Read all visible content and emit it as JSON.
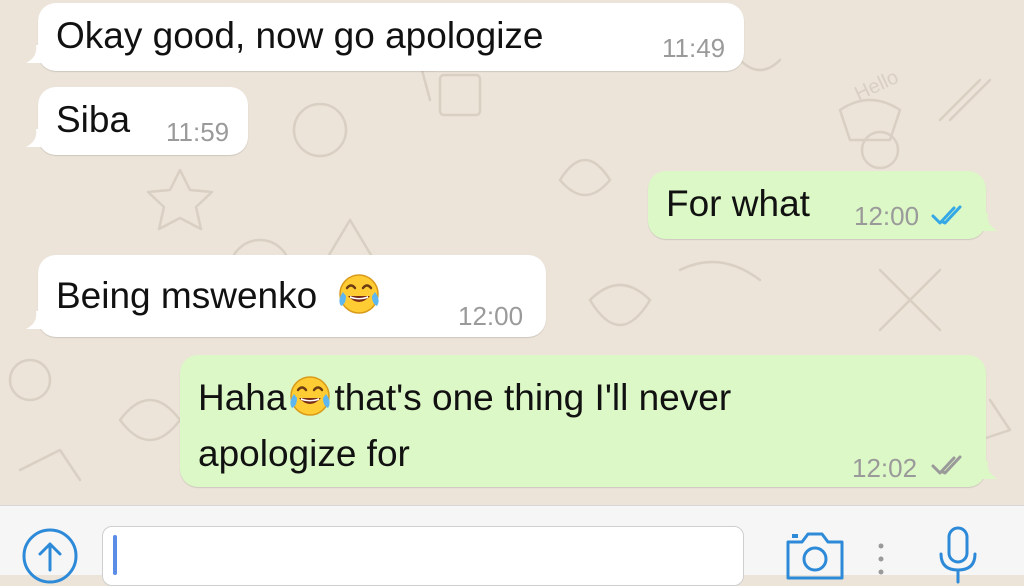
{
  "messages": [
    {
      "direction": "in",
      "text": "Okay good, now go apologize",
      "time": "11:49"
    },
    {
      "direction": "in",
      "text": "Siba",
      "time": "11:59"
    },
    {
      "direction": "out",
      "text": "For what",
      "time": "12:00",
      "status": "read",
      "status_color": "#34a8e6"
    },
    {
      "direction": "in",
      "text_before_emoji": "Being mswenko",
      "emoji": "face-with-tears-of-joy",
      "time": "12:00"
    },
    {
      "direction": "out",
      "line1_before": "Haha",
      "emoji": "face-with-tears-of-joy",
      "line1_after": "that's one thing I'll never",
      "line2": "apologize for",
      "time": "12:02",
      "status": "delivered",
      "status_color": "#9a9a9a"
    }
  ],
  "composer": {
    "value": "",
    "placeholder": ""
  },
  "icons": {
    "attach": "share-up-arrow-icon",
    "camera": "camera-icon",
    "more": "vertical-dots-icon",
    "mic": "microphone-icon"
  },
  "colors": {
    "incoming": "#ffffff",
    "outgoing": "#dcf8c6",
    "wallpaper": "#ece4d9",
    "accent": "#2d8ad8"
  }
}
